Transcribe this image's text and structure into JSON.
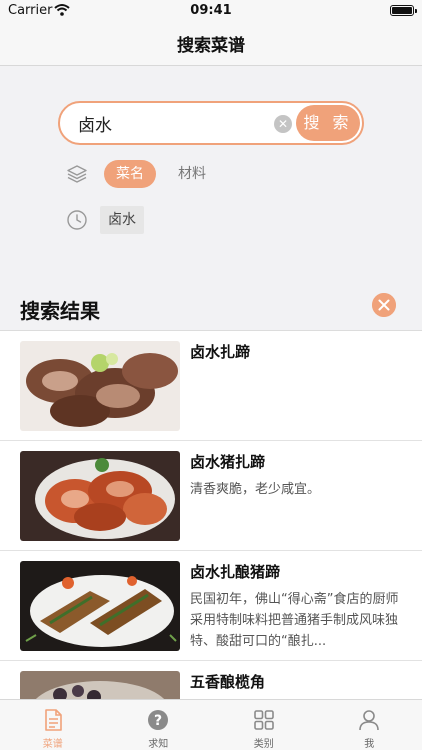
{
  "status_bar": {
    "carrier": "Carrier",
    "time": "09:41"
  },
  "nav": {
    "title": "搜索菜谱"
  },
  "search": {
    "value": "卤水",
    "button_label": "搜 索",
    "clear_glyph": "✕"
  },
  "filters": {
    "active": "菜名",
    "other": "材料"
  },
  "history": {
    "items": [
      "卤水"
    ]
  },
  "results": {
    "title": "搜索结果",
    "items": [
      {
        "title": "卤水扎蹄",
        "desc": ""
      },
      {
        "title": "卤水猪扎蹄",
        "desc": "清香爽脆，老少咸宜。"
      },
      {
        "title": "卤水扎酿猪蹄",
        "desc": "民国初年，佛山“得心斋”食店的厨师采用特制味料把普通猪手制成风味独特、酸甜可口的“酿扎..."
      },
      {
        "title": "五香酿榄角",
        "desc": ""
      }
    ]
  },
  "tabs": [
    {
      "label": "菜谱",
      "icon": "recipe-icon",
      "active": true
    },
    {
      "label": "求知",
      "icon": "question-icon",
      "active": false
    },
    {
      "label": "类别",
      "icon": "grid-icon",
      "active": false
    },
    {
      "label": "我",
      "icon": "user-icon",
      "active": false
    }
  ],
  "colors": {
    "accent": "#f0a27a",
    "background": "#f2f2f4"
  }
}
